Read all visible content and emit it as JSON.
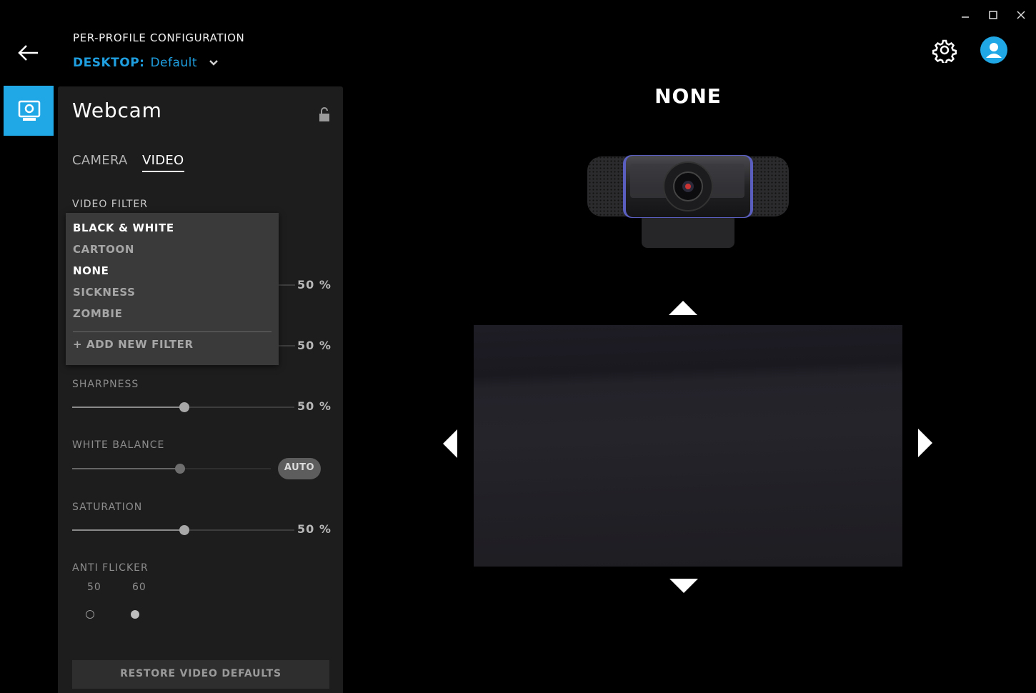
{
  "header": {
    "config_title": "PER-PROFILE CONFIGURATION",
    "profile_prefix": "DESKTOP:",
    "profile_name": "Default"
  },
  "panel": {
    "title": "Webcam",
    "tabs": [
      {
        "label": "CAMERA",
        "active": false
      },
      {
        "label": "VIDEO",
        "active": true
      }
    ],
    "video_filter": {
      "label": "VIDEO FILTER",
      "options": [
        {
          "label": "BLACK & WHITE",
          "style": "bright"
        },
        {
          "label": "CARTOON",
          "style": "dim"
        },
        {
          "label": "NONE",
          "style": "bright",
          "selected": true
        },
        {
          "label": "SICKNESS",
          "style": "dim"
        },
        {
          "label": "ZOMBIE",
          "style": "dim"
        }
      ],
      "add_new": "+ ADD NEW FILTER"
    },
    "hidden_slider_1": {
      "value_label": "50 %",
      "value": 0.5
    },
    "hidden_slider_2": {
      "value_label": "50 %",
      "value": 0.5
    },
    "sharpness": {
      "label": "SHARPNESS",
      "value_label": "50 %",
      "value": 0.5
    },
    "white_balance": {
      "label": "WHITE BALANCE",
      "auto_label": "AUTO",
      "value": 0.55
    },
    "saturation": {
      "label": "SATURATION",
      "value_label": "50 %",
      "value": 0.5
    },
    "anti_flicker": {
      "label": "ANTI FLICKER",
      "options": [
        "50",
        "60"
      ],
      "selected": "60"
    },
    "restore_label": "RESTORE VIDEO DEFAULTS"
  },
  "main": {
    "filter_name": "NONE"
  },
  "colors": {
    "accent": "#1fa7e6",
    "panel_bg": "#1d1d1d",
    "dropdown_bg": "#3a3a3a"
  },
  "icons": [
    "back-arrow-icon",
    "chevron-down-icon",
    "gear-icon",
    "user-icon",
    "webcam-device-icon",
    "lock-open-icon",
    "minimize-icon",
    "maximize-icon",
    "close-icon"
  ]
}
